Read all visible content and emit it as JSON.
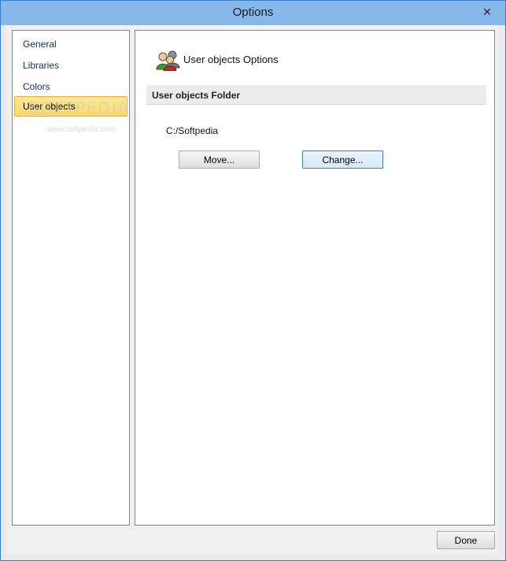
{
  "window": {
    "title": "Options",
    "close_label": "✕"
  },
  "sidebar": {
    "items": [
      {
        "label": "General",
        "active": false
      },
      {
        "label": "Libraries",
        "active": false
      },
      {
        "label": "Colors",
        "active": false
      },
      {
        "label": "User objects",
        "active": true
      }
    ]
  },
  "main": {
    "header_title": "User objects Options",
    "header_icon": "users-icon",
    "section_title": "User objects Folder",
    "folder_path": "C:/Softpedia",
    "move_label": "Move...",
    "change_label": "Change..."
  },
  "footer": {
    "done_label": "Done"
  },
  "watermark": {
    "large": "SOFTPEDIA",
    "small": "www.softpedia.com"
  },
  "colors": {
    "titlebar": "#86b8ea",
    "active_item": "#fbd86a",
    "accent_border": "#3c7fb1"
  }
}
